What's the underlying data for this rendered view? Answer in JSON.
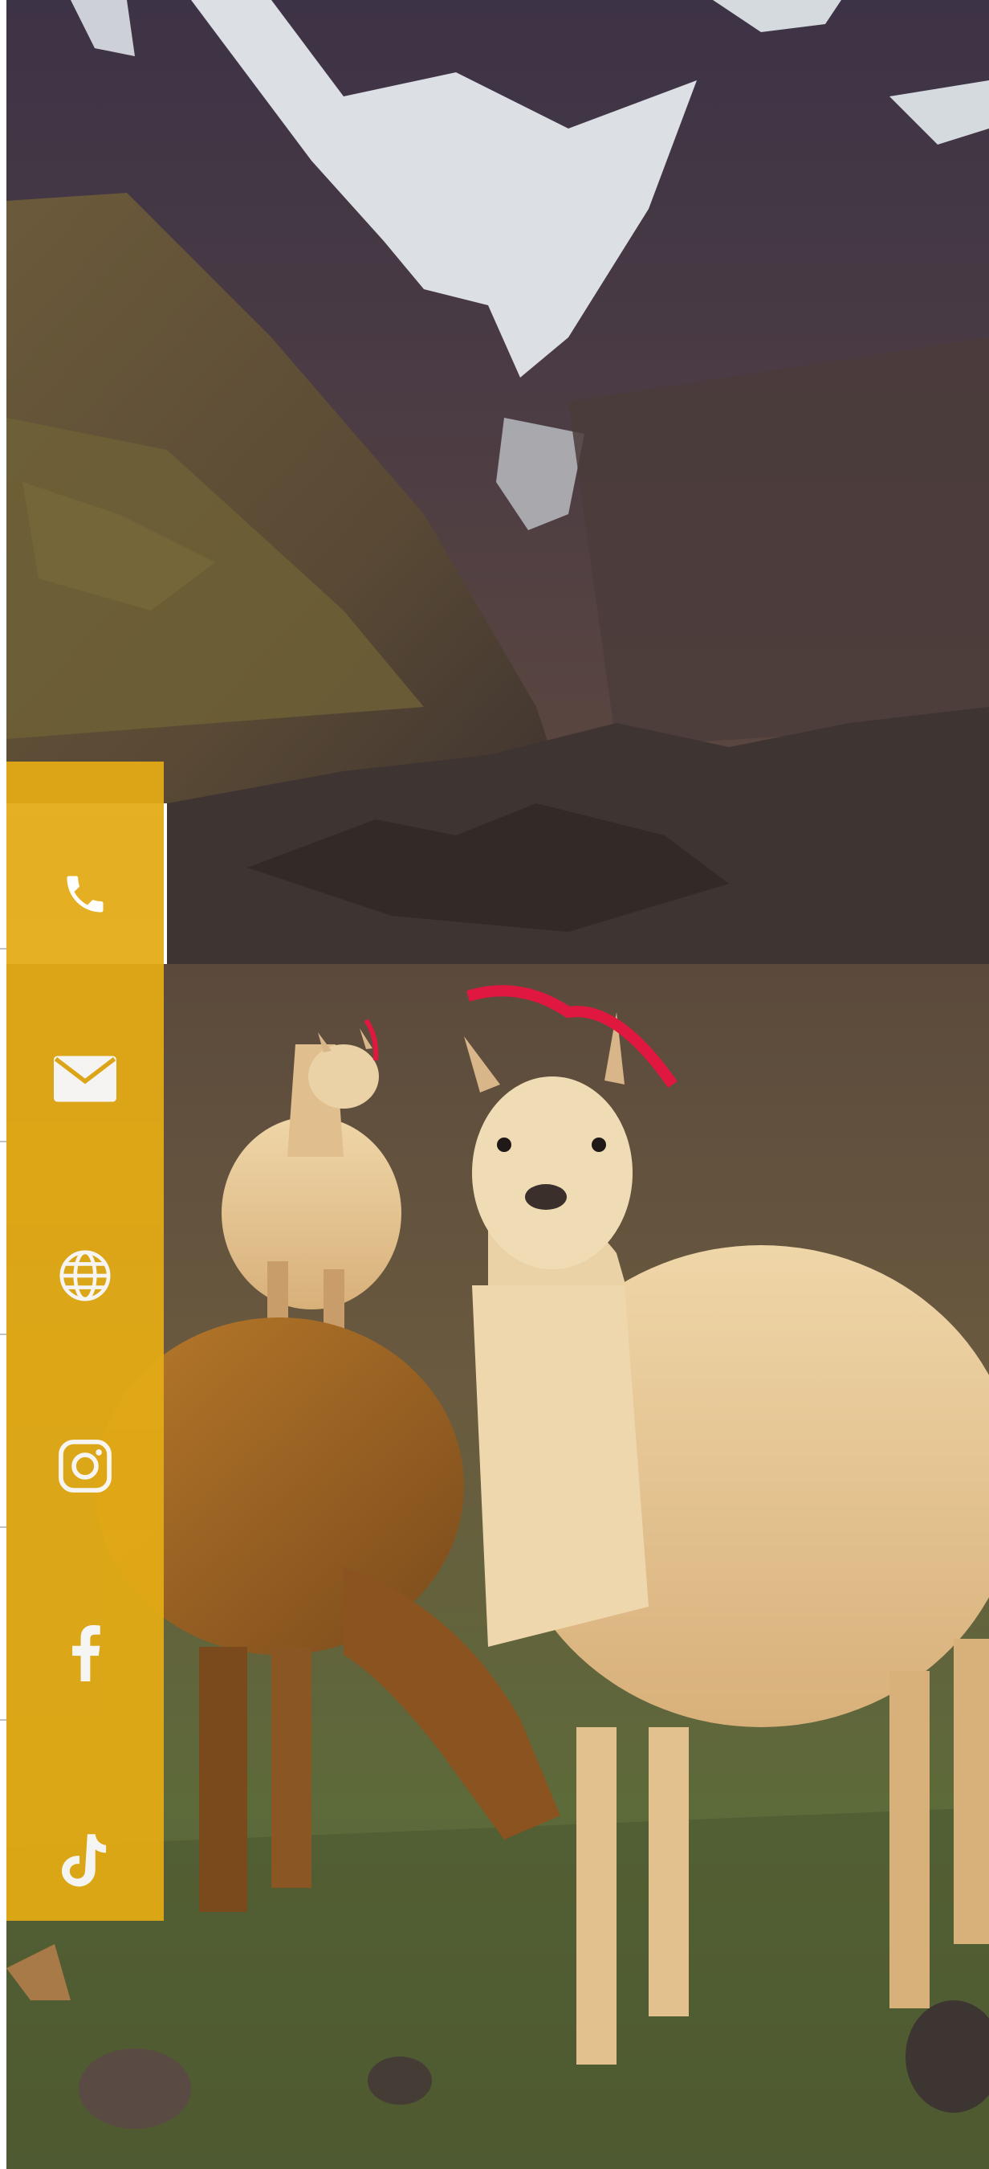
{
  "background": {
    "subject": "llamas-mountain-photo"
  },
  "colors": {
    "bar": "#e3ab15",
    "icon": "#ffffff"
  },
  "social": {
    "items": [
      {
        "name": "phone",
        "icon": "phone-icon"
      },
      {
        "name": "email",
        "icon": "envelope-icon"
      },
      {
        "name": "website",
        "icon": "globe-icon"
      },
      {
        "name": "instagram",
        "icon": "instagram-icon"
      },
      {
        "name": "facebook",
        "icon": "facebook-icon"
      },
      {
        "name": "tiktok",
        "icon": "tiktok-icon"
      }
    ]
  }
}
